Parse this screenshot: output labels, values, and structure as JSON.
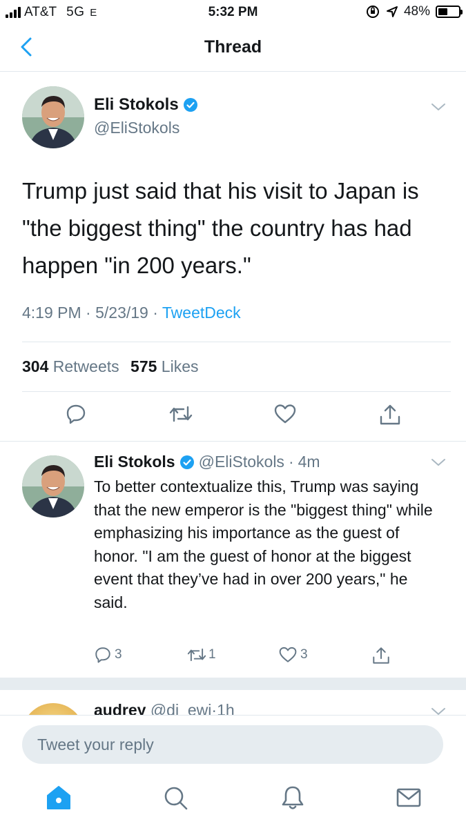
{
  "status_bar": {
    "carrier": "AT&T",
    "network": "5G",
    "network_suffix": "E",
    "time": "5:32 PM",
    "battery": "48%",
    "battery_level": 0.48
  },
  "nav": {
    "title": "Thread"
  },
  "main_tweet": {
    "name": "Eli Stokols",
    "handle": "@EliStokols",
    "text": "Trump just said that his visit to Japan is \"the biggest thing\" the country has had happen \"in 200 years.\"",
    "time": "4:19 PM",
    "sep1": "·",
    "date": "5/23/19",
    "sep2": "·",
    "source": "TweetDeck",
    "retweets_count": "304",
    "retweets_label": "Retweets",
    "likes_count": "575",
    "likes_label": "Likes"
  },
  "reply_tweet": {
    "name": "Eli Stokols",
    "handle": "@EliStokols",
    "sep": "·",
    "age": "4m",
    "text": "To better contextualize this, Trump was saying that the new emperor is the \"biggest thing\" while emphasizing his importance as the guest of honor. \"I am the guest of honor at the biggest event that they’ve had in over 200 years,\" he said.",
    "reply_count": "3",
    "retweet_count": "1",
    "like_count": "3"
  },
  "next_tweet": {
    "name": "audrey",
    "handle": "@di_ewi",
    "sep": "·",
    "age": "1h"
  },
  "composer": {
    "placeholder": "Tweet your reply"
  },
  "colors": {
    "accent": "#1da1f2",
    "secondary_text": "#657786",
    "divider": "#e1e8ed"
  },
  "icons": {
    "back": "chevron-left-icon",
    "verified": "verified-badge-icon",
    "caret": "chevron-down-icon",
    "reply": "comment-icon",
    "retweet": "retweet-icon",
    "like": "heart-icon",
    "share": "share-icon",
    "home": "home-icon",
    "search": "search-icon",
    "notifications": "bell-icon",
    "messages": "mail-icon"
  }
}
